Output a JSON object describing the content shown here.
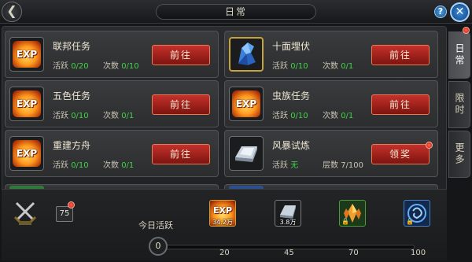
{
  "title": "日常",
  "tasks": [
    {
      "name": "联邦任务",
      "stat1_label": "活跃",
      "stat1_value": "0/20",
      "stat2_label": "次数",
      "stat2_value": "0/10",
      "button": "前往",
      "icon": "exp-icon"
    },
    {
      "name": "十面埋伏",
      "stat1_label": "活跃",
      "stat1_value": "0/10",
      "stat2_label": "次数",
      "stat2_value": "0/1",
      "button": "前往",
      "icon": "blue-crystal-icon"
    },
    {
      "name": "五色任务",
      "stat1_label": "活跃",
      "stat1_value": "0/10",
      "stat2_label": "次数",
      "stat2_value": "0/1",
      "button": "前往",
      "icon": "exp-icon"
    },
    {
      "name": "虫族任务",
      "stat1_label": "活跃",
      "stat1_value": "0/10",
      "stat2_label": "次数",
      "stat2_value": "0/1",
      "button": "前往",
      "icon": "exp-icon"
    },
    {
      "name": "重建方舟",
      "stat1_label": "活跃",
      "stat1_value": "0/10",
      "stat2_label": "次数",
      "stat2_value": "0/1",
      "button": "前往",
      "icon": "exp-icon"
    },
    {
      "name": "风暴试炼",
      "stat1_label": "活跃",
      "stat1_value": "无",
      "stat2_label": "层数",
      "stat2_value": "7/100",
      "button": "领奖",
      "icon": "silver-ingot-icon"
    }
  ],
  "side_tabs": [
    "日常",
    "限时",
    "更多"
  ],
  "activity": {
    "label": "今日活跃",
    "current": "0",
    "level_badge": "75",
    "milestones": [
      "20",
      "45",
      "70",
      "100"
    ],
    "rewards": [
      {
        "icon": "exp-icon",
        "qty": "34.2万",
        "locked": false
      },
      {
        "icon": "silver-ingot-icon",
        "qty": "3.8万",
        "locked": false
      },
      {
        "icon": "gold-crystal-icon",
        "qty": "",
        "locked": true
      },
      {
        "icon": "blue-rune-icon",
        "qty": "",
        "locked": true
      }
    ]
  },
  "colors": {
    "accent_red": "#b5241d",
    "progress_green": "#41d34a",
    "gold_border": "#c8a339"
  }
}
